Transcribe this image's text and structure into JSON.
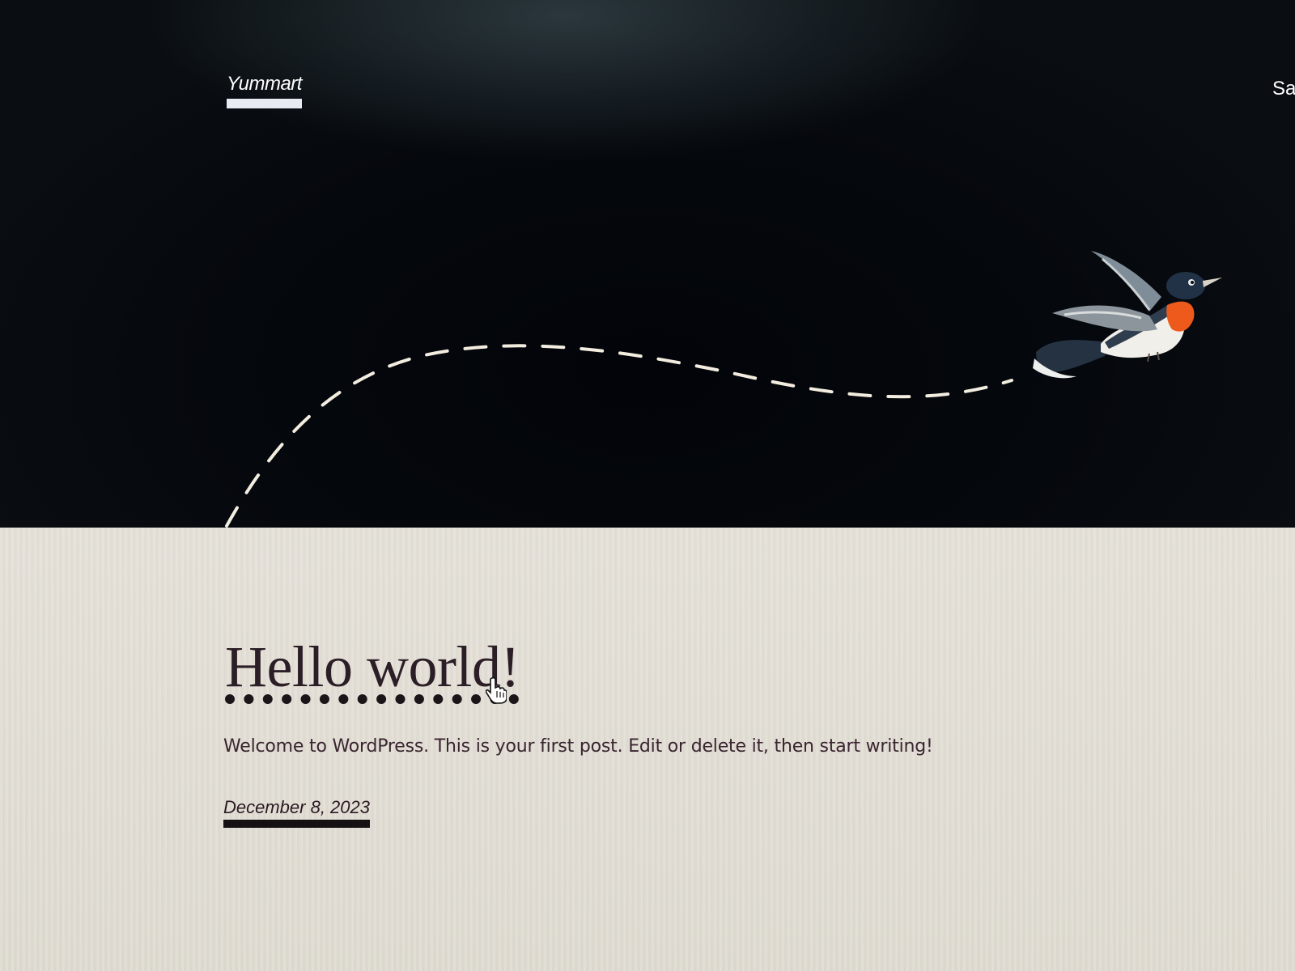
{
  "header": {
    "site_title": "Yummart",
    "nav": [
      "Sample Page"
    ]
  },
  "post": {
    "title": "Hello world!",
    "excerpt": "Welcome to WordPress. This is your first post. Edit or delete it, then start writing!",
    "date": "December 8, 2023"
  },
  "icons": {
    "hero_illustration": "flying-bird-icon",
    "cursor": "hand-pointer-icon"
  },
  "colors": {
    "header_bg": "#05080c",
    "content_bg": "#e1ddd3",
    "title_text": "#2b1e26",
    "link_underline": "#141014"
  }
}
